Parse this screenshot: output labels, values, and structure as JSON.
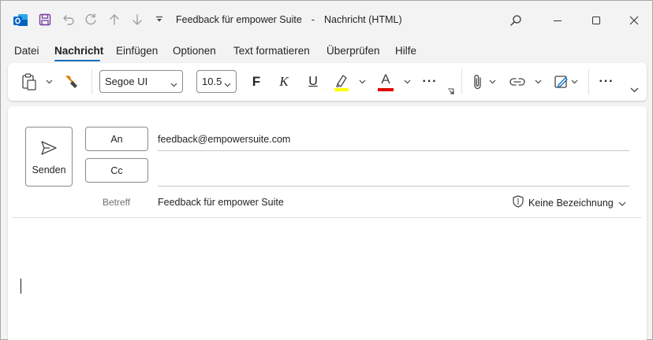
{
  "window": {
    "title": "Feedback für empower Suite",
    "subtitle": "Nachricht (HTML)",
    "title_separator": "-"
  },
  "menu": {
    "tabs": [
      {
        "label": "Datei"
      },
      {
        "label": "Nachricht"
      },
      {
        "label": "Einfügen"
      },
      {
        "label": "Optionen"
      },
      {
        "label": "Text formatieren"
      },
      {
        "label": "Überprüfen"
      },
      {
        "label": "Hilfe"
      }
    ],
    "active": "Nachricht"
  },
  "ribbon": {
    "font_name": "Segoe UI",
    "font_size": "10.5",
    "bold_label": "F",
    "italic_label": "K",
    "underline_label": "U",
    "font_color_label": "A",
    "highlight_color": "#ffff00",
    "font_color": "#e00000",
    "more_label": "···"
  },
  "compose": {
    "send_label": "Senden",
    "to_label": "An",
    "cc_label": "Cc",
    "to_value": "feedback@empowersuite.com",
    "cc_value": "",
    "subject_label": "Betreff",
    "subject_value": "Feedback für empower Suite",
    "sensitivity_label": "Keine Bezeichnung"
  },
  "colors": {
    "accent": "#0f6cbd",
    "outlook_blue": "#0a64c8",
    "save_purple": "#7b3fa0"
  }
}
